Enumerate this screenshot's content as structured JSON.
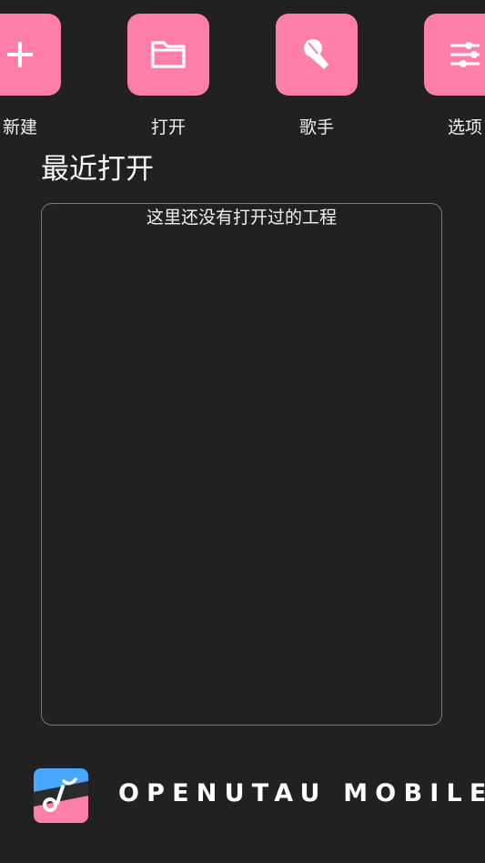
{
  "actions": [
    {
      "label": "新建",
      "icon": "plus-icon"
    },
    {
      "label": "打开",
      "icon": "folder-icon"
    },
    {
      "label": "歌手",
      "icon": "microphone-icon"
    },
    {
      "label": "选项",
      "icon": "sliders-icon"
    }
  ],
  "recent": {
    "title": "最近打开",
    "empty_text": "这里还没有打开过的工程"
  },
  "brand": {
    "name": "OPENUTAU MOBILE",
    "logo_icon": "openutau-logo-icon"
  },
  "colors": {
    "background": "#212121",
    "accent": "#ff7fa8",
    "border": "#777777",
    "text": "#ffffff"
  }
}
